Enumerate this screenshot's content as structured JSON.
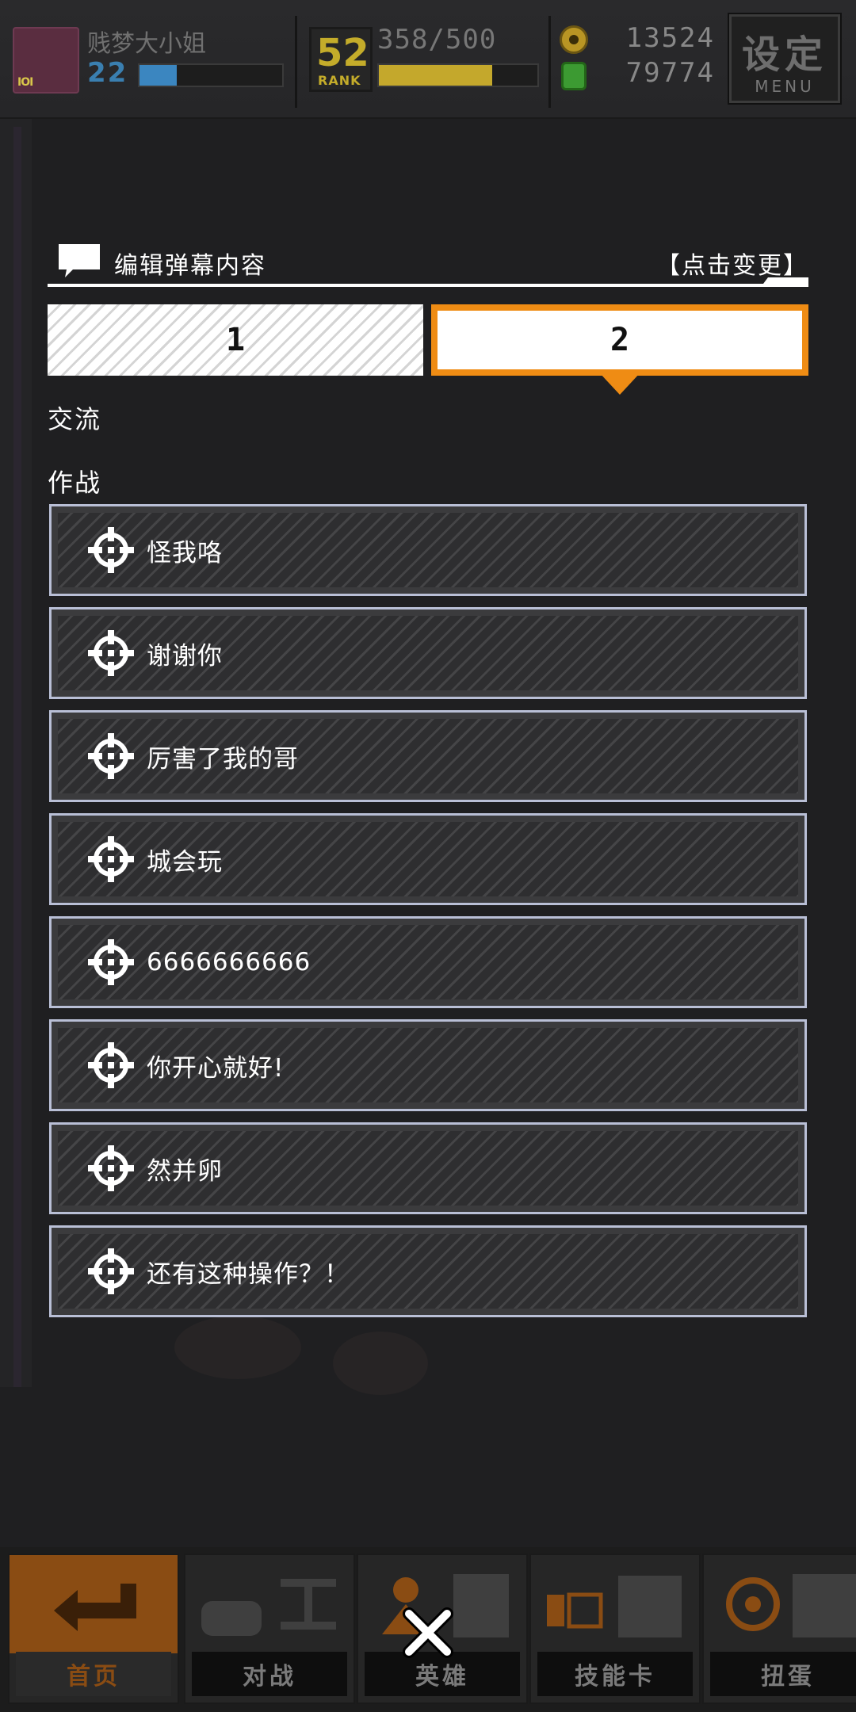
{
  "topbar": {
    "player_name": "贱梦大小姐",
    "player_level": "22",
    "xp_fraction": 0.26,
    "rank_number": "52",
    "rank_label": "RANK",
    "stamina_text": "358/500",
    "stamina_fraction": 0.716,
    "coins": "13524",
    "gems": "79774",
    "menu_label_main": "设定",
    "menu_label_sub": "MENU"
  },
  "header": {
    "title": "编辑弹幕内容",
    "change_link": "【点击变更】"
  },
  "tabs": [
    {
      "label": "1",
      "selected": false
    },
    {
      "label": "2",
      "selected": true
    }
  ],
  "sections": {
    "exchange": "交流",
    "battle": "作战"
  },
  "items": [
    {
      "text": "怪我咯"
    },
    {
      "text": "谢谢你"
    },
    {
      "text": "厉害了我的哥"
    },
    {
      "text": "城会玩"
    },
    {
      "text": "6666666666"
    },
    {
      "text": "你开心就好!"
    },
    {
      "text": "然并卵"
    },
    {
      "text": "还有这种操作？！"
    }
  ],
  "nav": [
    {
      "label": "首页",
      "icon": "home-return-icon"
    },
    {
      "label": "对战",
      "icon": "gamepad-icon"
    },
    {
      "label": "英雄",
      "icon": "hero-icon"
    },
    {
      "label": "技能卡",
      "icon": "skill-card-icon"
    },
    {
      "label": "扭蛋",
      "icon": "gacha-icon"
    }
  ],
  "colors": {
    "accent": "#ef8c14",
    "item_border": "#b9bfd6",
    "background": "#1f1f21"
  }
}
